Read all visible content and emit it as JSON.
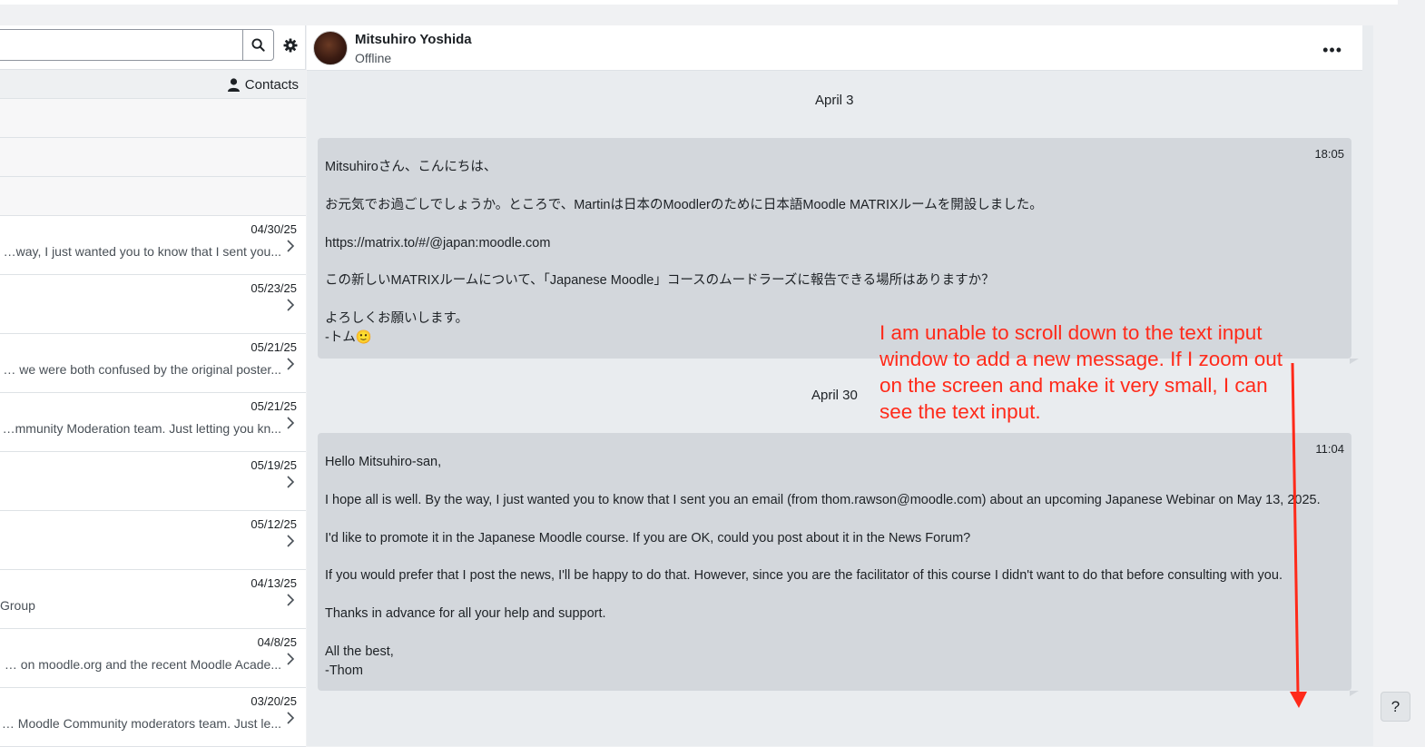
{
  "search": {
    "placeholder": ""
  },
  "contacts_label": "Contacts",
  "conversations": [
    {
      "date": "04/30/25",
      "snippet": "I hope all is well. By the way, I just wanted you to know that I sent you..."
    },
    {
      "date": "05/23/25",
      "snippet": ""
    },
    {
      "date": "05/21/25",
      "snippet": "I'm guessing we were both confused by the original poster..."
    },
    {
      "date": "05/21/25",
      "snippet": "I've joined the Moodle Community Moderation team. Just letting you kn..."
    },
    {
      "date": "05/19/25",
      "snippet": ""
    },
    {
      "date": "05/12/25",
      "snippet": ""
    },
    {
      "date": "04/13/25",
      "snippet": "Group"
    },
    {
      "date": "04/8/25",
      "snippet": "Thanks for all your posts on moodle.org and the recent Moodle Acade..."
    },
    {
      "date": "03/20/25",
      "snippet": "Welcome to the Moodle Community moderators team. Just le..."
    }
  ],
  "header": {
    "name": "Mitsuhiro Yoshida",
    "status": "Offline",
    "more": "•••"
  },
  "messages": [
    {
      "day": "April 3",
      "time": "18:05",
      "lines": [
        "Mitsuhiroさん、こんにちは、",
        "",
        "お元気でお過ごしでしょうか。ところで、Martinは日本のMoodlerのために日本語Moodle MATRIXルームを開設しました。",
        "",
        "https://matrix.to/#/@japan:moodle.com",
        "",
        "この新しいMATRIXルームについて、「Japanese Moodle」コースのムードラーズに報告できる場所はありますか？",
        "",
        "よろしくお願いします。",
        "-トム🙂"
      ]
    },
    {
      "day": "April 30",
      "time": "11:04",
      "lines": [
        "Hello Mitsuhiro-san,",
        "",
        "I hope all is well. By the way, I just wanted you to know that I sent you an email (from thom.rawson@moodle.com) about an upcoming Japanese Webinar on May 13, 2025.",
        "",
        "I'd like to promote it in the Japanese Moodle course. If you are OK, could you post about it in the News Forum?",
        "",
        "If you would prefer that I post the news, I'll be happy to do that. However, since you are the facilitator of this course I didn't want to do that before consulting with you.",
        "",
        "Thanks in advance for all your help and support.",
        "",
        "All the best,",
        "-Thom"
      ]
    }
  ],
  "annotation": "I am unable to scroll down to the text input window to add a new message. If I zoom out on the screen and make it very small, I can see the text input.",
  "help_label": "?",
  "colors": {
    "annotation": "#ff2a1a",
    "bubble": "#d3d7dc",
    "panel": "#e9ecef"
  }
}
